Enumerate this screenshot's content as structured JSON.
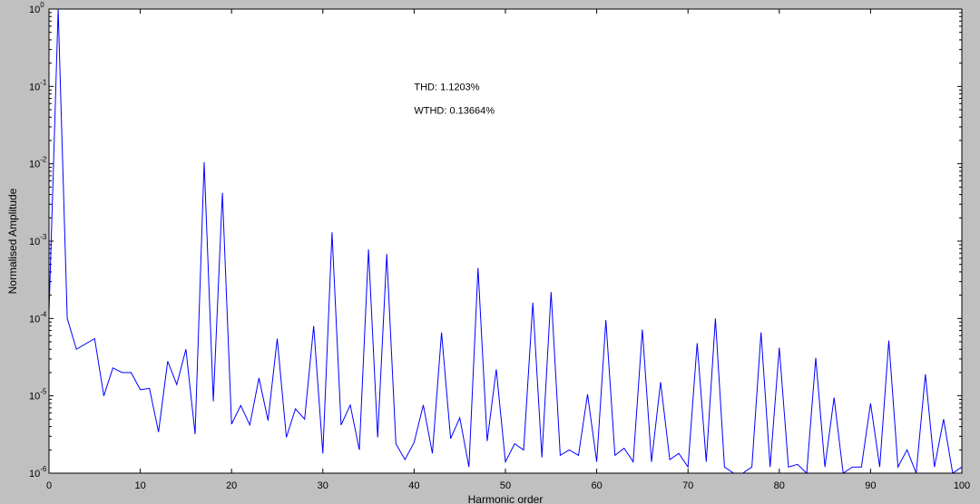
{
  "chart_data": {
    "type": "line",
    "title": "",
    "xlabel": "Harmonic order",
    "ylabel": "Normalised Amplitude",
    "xlim": [
      0,
      100
    ],
    "ylim": [
      1e-06,
      1
    ],
    "yscale": "log",
    "grid": false,
    "x_ticks": [
      0,
      10,
      20,
      30,
      40,
      50,
      60,
      70,
      80,
      90,
      100
    ],
    "y_ticks": [
      {
        "base": "10",
        "exp": "-6"
      },
      {
        "base": "10",
        "exp": "-5"
      },
      {
        "base": "10",
        "exp": "-4"
      },
      {
        "base": "10",
        "exp": "-3"
      },
      {
        "base": "10",
        "exp": "-2"
      },
      {
        "base": "10",
        "exp": "-1"
      },
      {
        "base": "10",
        "exp": "0"
      }
    ],
    "annotations": [
      "THD: 1.1203%",
      "WTHD: 0.13664%"
    ],
    "series": [
      {
        "color": "#0000ff",
        "x": [
          0,
          0.5,
          1,
          1.5,
          2,
          3,
          5,
          6,
          7,
          8,
          9,
          10,
          11,
          12,
          13,
          14,
          15,
          16,
          17,
          18,
          19,
          20,
          21,
          22,
          23,
          24,
          25,
          26,
          27,
          28,
          29,
          30,
          31,
          32,
          33,
          34,
          35,
          36,
          37,
          38,
          39,
          40,
          41,
          42,
          43,
          44,
          45,
          46,
          47,
          48,
          49,
          50,
          51,
          52,
          53,
          54,
          55,
          56,
          57,
          58,
          59,
          60,
          61,
          62,
          63,
          64,
          65,
          66,
          67,
          68,
          69,
          70,
          71,
          72,
          73,
          74,
          75,
          76,
          77,
          78,
          79,
          80,
          81,
          82,
          83,
          84,
          85,
          86,
          87,
          88,
          89,
          90,
          91,
          92,
          93,
          94,
          95,
          96,
          97,
          98,
          99,
          100
        ],
        "values": [
          0.00012,
          0.01,
          1.0,
          0.01,
          0.0001,
          4e-05,
          5.5e-05,
          1e-05,
          2.3e-05,
          2e-05,
          2e-05,
          1.2e-05,
          1.25e-05,
          3.4e-06,
          2.8e-05,
          1.4e-05,
          4e-05,
          3.2e-06,
          0.0105,
          8.5e-06,
          0.0042,
          4.3e-06,
          7.5e-06,
          4.2e-06,
          1.7e-05,
          4.8e-06,
          5.5e-05,
          2.9e-06,
          6.8e-06,
          5e-06,
          8e-05,
          1.8e-06,
          0.0013,
          4.2e-06,
          7.6e-06,
          2e-06,
          0.00078,
          2.9e-06,
          0.00068,
          2.4e-06,
          1.5e-06,
          2.5e-06,
          7.6e-06,
          1.8e-06,
          6.6e-05,
          2.8e-06,
          5.2e-06,
          1.2e-06,
          0.00045,
          2.6e-06,
          2.2e-05,
          1.4e-06,
          2.4e-06,
          2e-06,
          0.00016,
          1.6e-06,
          0.00022,
          1.7e-06,
          2e-06,
          1.7e-06,
          1.05e-05,
          1.4e-06,
          9.5e-05,
          1.7e-06,
          2.1e-06,
          1.4e-06,
          7.2e-05,
          1.4e-06,
          1.5e-05,
          1.5e-06,
          1.8e-06,
          1.2e-06,
          4.8e-05,
          1.4e-06,
          0.0001,
          1.2e-06,
          1e-06,
          1e-06,
          1.2e-06,
          6.6e-05,
          1.2e-06,
          4.2e-05,
          1.2e-06,
          1.3e-06,
          1e-06,
          3.1e-05,
          1.2e-06,
          9.5e-06,
          1e-06,
          1.2e-06,
          1.2e-06,
          8e-06,
          1.2e-06,
          5.2e-05,
          1.2e-06,
          2e-06,
          1e-06,
          1.9e-05,
          1.2e-06,
          5e-06,
          1e-06,
          1.2e-06
        ]
      }
    ]
  }
}
